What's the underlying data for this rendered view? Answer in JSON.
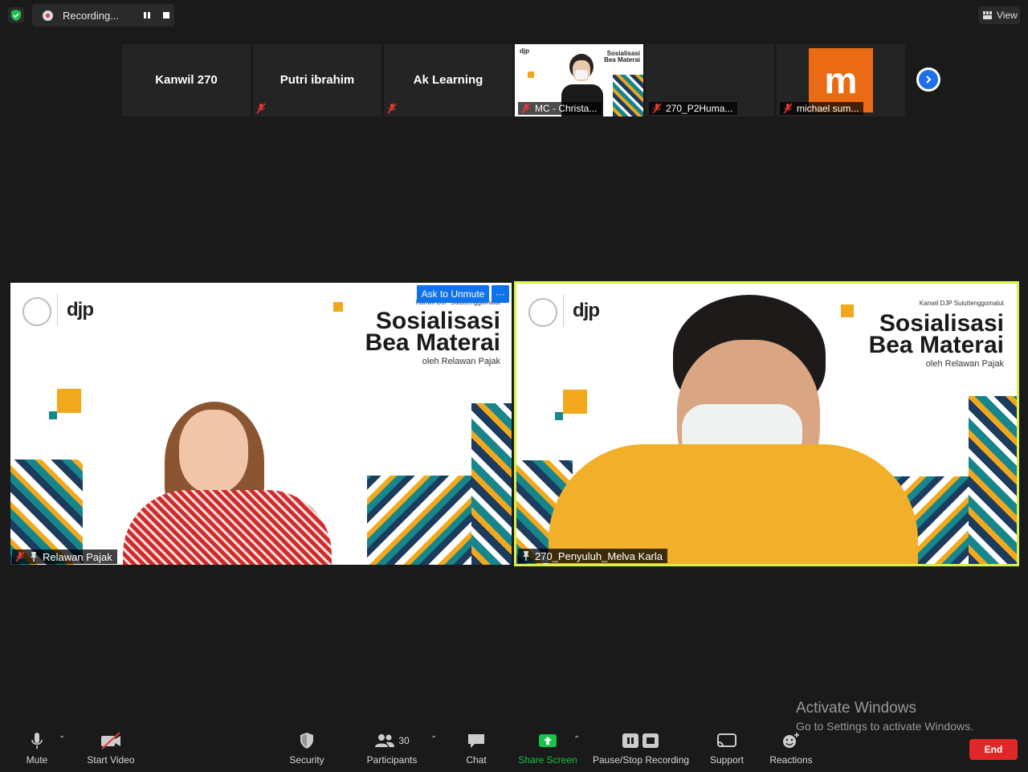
{
  "recording": {
    "status_label": "Recording..."
  },
  "view_button": {
    "label": "View"
  },
  "thumbnails": [
    {
      "name": "Kanwil 270",
      "label": ""
    },
    {
      "name": "Putri ibrahim",
      "label": ""
    },
    {
      "name": "Ak Learning",
      "label": ""
    },
    {
      "name": "",
      "label": "MC - Christa..."
    },
    {
      "name": "",
      "label": "270_P2Huma..."
    },
    {
      "name": "",
      "label": "michael sum...",
      "avatar_letter": "m",
      "avatar_color": "#ea6b13"
    }
  ],
  "slide": {
    "logo_text": "djp",
    "organizer": "Kanwil DJP Suluttenggomalut",
    "title_line1": "Sosialisasi",
    "title_line2": "Bea Materai",
    "byline": "oleh Relawan Pajak"
  },
  "main_tiles": {
    "left_label": "Relawan Pajak",
    "right_label": "270_Penyuluh_Melva Karla",
    "active_speaker_color": "#d6f04c"
  },
  "tile_actions": {
    "ask_to_unmute": "Ask to Unmute",
    "more": "···"
  },
  "windows_watermark": {
    "title": "Activate Windows",
    "subtitle": "Go to Settings to activate Windows."
  },
  "toolbar": {
    "mute": "Mute",
    "start_video": "Start Video",
    "security": "Security",
    "participants": "Participants",
    "participants_count": "30",
    "chat": "Chat",
    "share_screen": "Share Screen",
    "pause_stop_recording": "Pause/Stop Recording",
    "support": "Support",
    "reactions": "Reactions",
    "end": "End",
    "share_color": "#19c24b",
    "end_color": "#e02828"
  }
}
